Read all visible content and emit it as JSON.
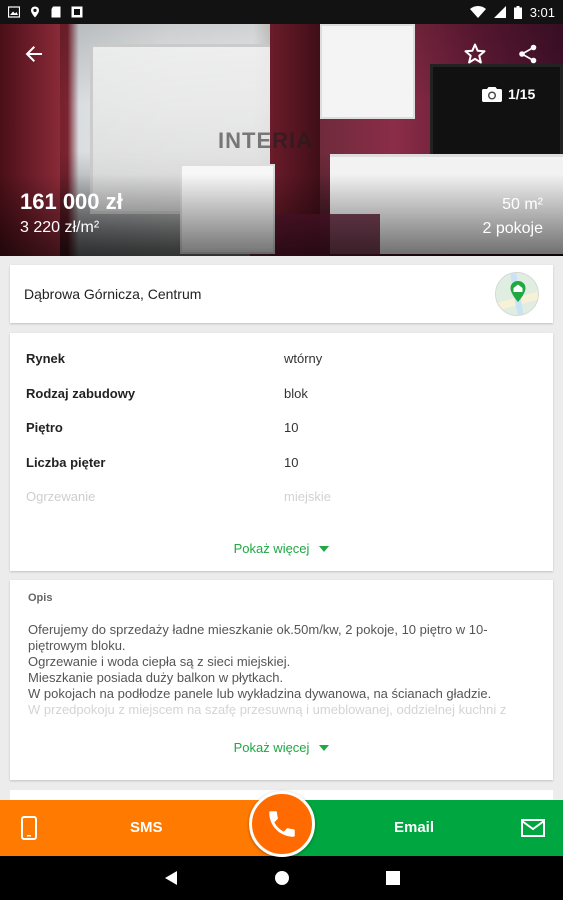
{
  "status_bar": {
    "time": "3:01",
    "left_icons": [
      "image-icon",
      "location-icon",
      "sd-card-icon",
      "notification-icon"
    ],
    "right_icons": [
      "wifi-icon",
      "signal-icon",
      "battery-icon"
    ]
  },
  "hero": {
    "watermark": "INTERIA",
    "photo_counter": "1/15",
    "price": "161 000 zł",
    "price_per_m2": "3 220 zł/m²",
    "area": "50 m²",
    "rooms": "2 pokoje"
  },
  "location": {
    "text": "Dąbrowa Górnicza, Centrum"
  },
  "details": {
    "rows": [
      {
        "label": "Rynek",
        "value": "wtórny"
      },
      {
        "label": "Rodzaj zabudowy",
        "value": "blok"
      },
      {
        "label": "Piętro",
        "value": "10"
      },
      {
        "label": "Liczba pięter",
        "value": "10"
      },
      {
        "label": "Ogrzewanie",
        "value": "miejskie"
      }
    ],
    "more_label": "Pokaż więcej"
  },
  "description": {
    "title": "Opis",
    "lines": [
      "Oferujemy do sprzedaży ładne mieszkanie ok.50m/kw, 2 pokoje, 10 piętro w 10-",
      "piętrowym bloku.",
      "Ogrzewanie i woda ciepła są z sieci miejskiej.",
      "Mieszkanie posiada duży balkon w płytkach.",
      "W pokojach na podłodze panele lub wykładzina dywanowa, na ścianach gładzie.",
      "W przedpokoju z miejscem na szafę przesuwną i umeblowanej, oddzielnej kuchni z"
    ],
    "more_label": "Pokaż więcej"
  },
  "actions": {
    "sms_label": "SMS",
    "email_label": "Email",
    "colors": {
      "sms": "#ff7a00",
      "email": "#00a63f",
      "call": "#ff6b00",
      "accent": "#1fa843"
    }
  }
}
